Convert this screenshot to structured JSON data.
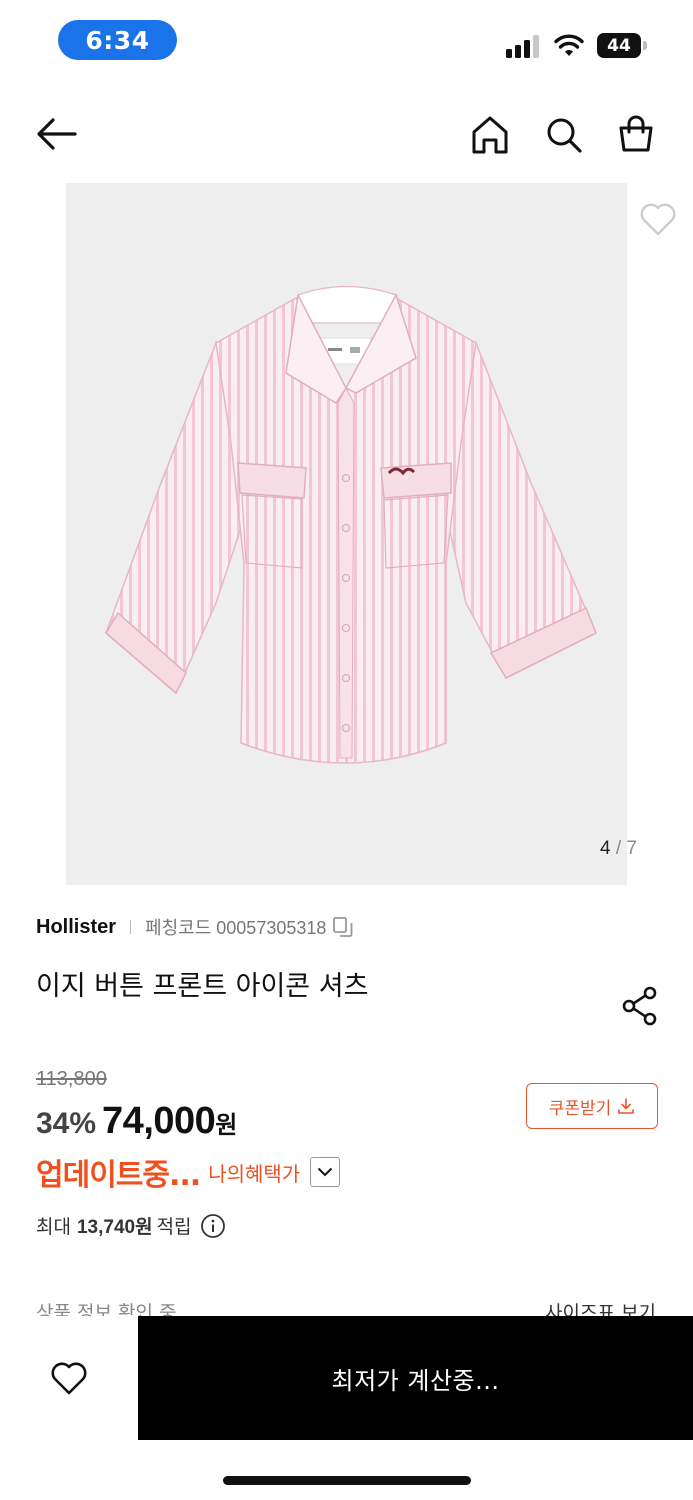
{
  "status_bar": {
    "time": "6:34",
    "battery": "44",
    "icons": [
      "signal-icon",
      "wifi-icon",
      "battery-icon"
    ]
  },
  "header": {
    "icons": [
      "back-arrow-icon",
      "home-icon",
      "search-icon",
      "shopping-bag-icon"
    ]
  },
  "gallery": {
    "current": "4",
    "separator": "/",
    "total": "7",
    "icons": [
      "heart-outline-icon"
    ]
  },
  "product": {
    "brand": "Hollister",
    "fetch_code_label": "페칭코드 00057305318",
    "title": "이지 버튼 프론트 아이콘 셔츠",
    "icons": [
      "copy-icon",
      "share-icon"
    ]
  },
  "price": {
    "original": "113,800",
    "discount_rate": "34%",
    "sale_price": "74,000",
    "currency": "원",
    "coupon_label": "쿠폰받기",
    "updating_label": "업데이트중...",
    "my_benefit_label": "나의혜택가",
    "points_prefix": "최대",
    "points_amount": "13,740원",
    "points_suffix": "적립",
    "accent_color": "#f0501e",
    "icons": [
      "download-icon",
      "chevron-down-icon",
      "info-icon"
    ]
  },
  "partially_visible": {
    "left": "상품 정보 확인 중...",
    "right": "사이즈표 보기"
  },
  "bottom_bar": {
    "buy_label": "최저가 계산중...",
    "icons": [
      "heart-outline-icon"
    ]
  }
}
